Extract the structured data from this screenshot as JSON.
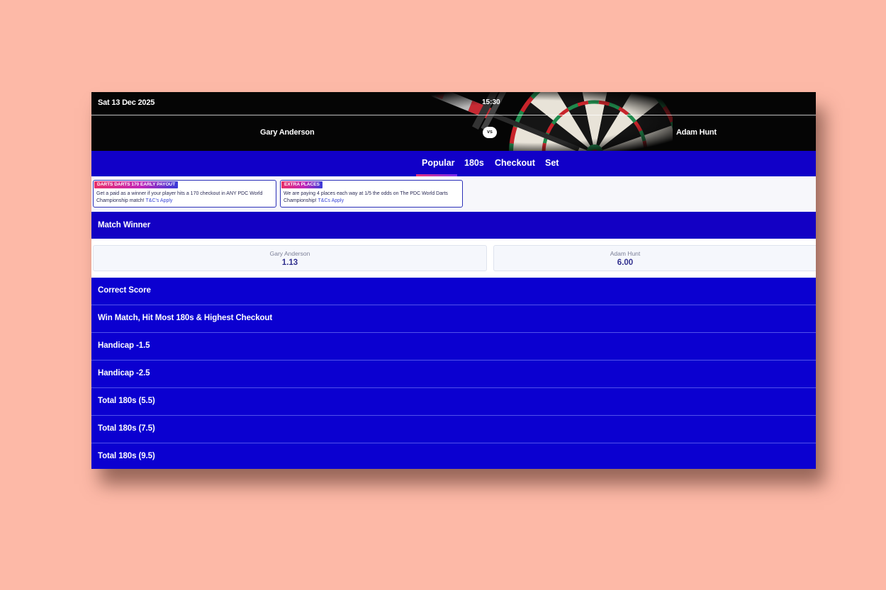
{
  "match": {
    "date": "Sat 13 Dec 2025",
    "time": "15:30",
    "home_player": "Gary Anderson",
    "away_player": "Adam Hunt",
    "vs_label": "vs"
  },
  "tabs": [
    {
      "label": "Popular",
      "active": true
    },
    {
      "label": "180s",
      "active": false
    },
    {
      "label": "Checkout",
      "active": false
    },
    {
      "label": "Set",
      "active": false
    }
  ],
  "promos": [
    {
      "badge": "DARTS DARTS 170 EARLY PAYOUT",
      "text": "Get a paid as a winner if your player hits a 170 checkout in ANY PDC World Championship match!",
      "link": "T&C's Apply"
    },
    {
      "badge": "EXTRA PLACES",
      "text": "We are paying 4 places each way at 1/5 the odds on The PDC World Darts Championship!",
      "link": "T&Cs Apply"
    }
  ],
  "match_winner": {
    "title": "Match Winner",
    "selections": [
      {
        "name": "Gary Anderson",
        "price": "1.13"
      },
      {
        "name": "Adam Hunt",
        "price": "6.00"
      }
    ]
  },
  "markets": [
    "Correct Score",
    "Win Match, Hit Most 180s & Highest Checkout",
    "Handicap -1.5",
    "Handicap -2.5",
    "Total 180s (5.5)",
    "Total 180s (7.5)",
    "Total 180s (9.5)"
  ],
  "colors": {
    "background": "#fdb9a7",
    "header_bg": "#050505",
    "market_bg": "#0b00d0",
    "tab_bg": "#1100c8",
    "accent": "#e8307a",
    "price": "#31308e"
  }
}
